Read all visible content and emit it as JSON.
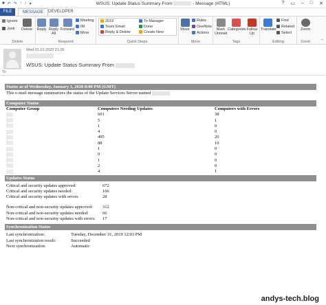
{
  "window": {
    "title": "WSUS: Update Status Summary From",
    "title_suffix": "- Message (HTML)",
    "controls": [
      "?",
      "▭",
      "–",
      "□",
      "✕"
    ]
  },
  "tabs": [
    "FILE",
    "MESSAGE",
    "DEVELOPER"
  ],
  "ribbon": {
    "delete": {
      "ignore": "Ignore",
      "junk": "Junk",
      "delete": "Delete",
      "label": "Delete"
    },
    "respond": {
      "reply": "Reply",
      "reply_all": "Reply All",
      "forward": "Forward",
      "meeting": "Meeting",
      "im": "IM",
      "more": "More",
      "label": "Respond"
    },
    "quick_steps": {
      "items": [
        "2019",
        "Team Email",
        "Reply & Delete",
        "To Manager",
        "Done",
        "Create New"
      ],
      "label": "Quick Steps"
    },
    "move": {
      "move": "Move",
      "rules": "Rules",
      "onenote": "OneNote",
      "actions": "Actions",
      "label": "Move"
    },
    "tags": {
      "mark_unread": "Mark Unread",
      "categorize": "Categorize",
      "follow_up": "Follow Up",
      "label": "Tags"
    },
    "editing": {
      "translate": "Translate",
      "find": "Find",
      "related": "Related",
      "select": "Select",
      "label": "Editing"
    },
    "zoom": {
      "zoom": "Zoom",
      "label": "Zoom"
    }
  },
  "header": {
    "date": "Wed 01.01.2020 21:00",
    "subject": "WSUS: Update Status Summary From",
    "to_label": "To"
  },
  "report": {
    "status_title": "Status as of Wednesday, January 1, 2020 8:00 PM (GMT)",
    "intro": "This e-mail message summarizes the status of the Update Services Server named",
    "computer_status": {
      "heading": "Computer Status",
      "columns": [
        "Computer Group",
        "Computers Needing Updates",
        "Computers with Errors"
      ],
      "rows": [
        {
          "needing": "601",
          "errors": "38"
        },
        {
          "needing": "5",
          "errors": "1"
        },
        {
          "needing": "1",
          "errors": "0"
        },
        {
          "needing": "4",
          "errors": "0"
        },
        {
          "needing": "495",
          "errors": "26"
        },
        {
          "needing": "88",
          "errors": "10"
        },
        {
          "needing": "1",
          "errors": "0"
        },
        {
          "needing": "0",
          "errors": "0"
        },
        {
          "needing": "1",
          "errors": "0"
        },
        {
          "needing": "2",
          "errors": "0"
        },
        {
          "needing": "4",
          "errors": "1"
        }
      ]
    },
    "updates_status": {
      "heading": "Updates Status",
      "rows": [
        {
          "label": "Critical and security updates approved:",
          "value": "672"
        },
        {
          "label": "Critical and security updates needed:",
          "value": "166"
        },
        {
          "label": "Critical and security updates with errors:",
          "value": "28"
        },
        {
          "label": "Non-critical and non-security updates approved:",
          "value": "312"
        },
        {
          "label": "Non-critical and non-security updates needed:",
          "value": "66"
        },
        {
          "label": "Non-critical and non-security updates with errors:",
          "value": "17"
        }
      ]
    },
    "sync_status": {
      "heading": "Synchronization Status",
      "rows": [
        {
          "label": "Last synchronization:",
          "value": "Tuesday, December 31, 2019 12:03 PM"
        },
        {
          "label": "Last synchronization result:",
          "value": "Succeeded"
        },
        {
          "label": "Next synchronization:",
          "value": "Automatic"
        }
      ]
    }
  },
  "watermark": "andys-tech.blog",
  "colors": {
    "accent": "#2b579a",
    "section_bar": "#8f8f8f"
  }
}
